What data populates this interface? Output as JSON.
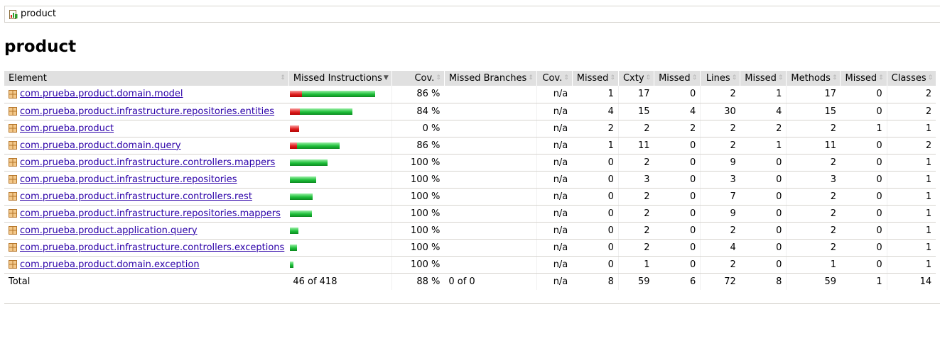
{
  "breadcrumb": {
    "label": "product"
  },
  "page_title": "product",
  "columns": [
    {
      "label": "Element"
    },
    {
      "label": "Missed Instructions"
    },
    {
      "label": "Cov."
    },
    {
      "label": "Missed Branches"
    },
    {
      "label": "Cov."
    },
    {
      "label": "Missed"
    },
    {
      "label": "Cxty"
    },
    {
      "label": "Missed"
    },
    {
      "label": "Lines"
    },
    {
      "label": "Missed"
    },
    {
      "label": "Methods"
    },
    {
      "label": "Missed"
    },
    {
      "label": "Classes"
    }
  ],
  "rows": [
    {
      "name": "com.prueba.product.domain.model",
      "instr_missed_fraction": 0.14,
      "instr_bar_total": 1.0,
      "cov": "86 %",
      "br_cov": "n/a",
      "cxty_missed": "1",
      "cxty": "17",
      "lines_missed": "0",
      "lines": "2",
      "methods_missed": "1",
      "methods": "17",
      "classes_missed": "0",
      "classes": "2"
    },
    {
      "name": "com.prueba.product.infrastructure.repositories.entities",
      "instr_missed_fraction": 0.16,
      "instr_bar_total": 0.73,
      "cov": "84 %",
      "br_cov": "n/a",
      "cxty_missed": "4",
      "cxty": "15",
      "lines_missed": "4",
      "lines": "30",
      "methods_missed": "4",
      "methods": "15",
      "classes_missed": "0",
      "classes": "2"
    },
    {
      "name": "com.prueba.product",
      "instr_missed_fraction": 1.0,
      "instr_bar_total": 0.11,
      "cov": "0 %",
      "br_cov": "n/a",
      "cxty_missed": "2",
      "cxty": "2",
      "lines_missed": "2",
      "lines": "2",
      "methods_missed": "2",
      "methods": "2",
      "classes_missed": "1",
      "classes": "1"
    },
    {
      "name": "com.prueba.product.domain.query",
      "instr_missed_fraction": 0.14,
      "instr_bar_total": 0.58,
      "cov": "86 %",
      "br_cov": "n/a",
      "cxty_missed": "1",
      "cxty": "11",
      "lines_missed": "0",
      "lines": "2",
      "methods_missed": "1",
      "methods": "11",
      "classes_missed": "0",
      "classes": "2"
    },
    {
      "name": "com.prueba.product.infrastructure.controllers.mappers",
      "instr_missed_fraction": 0.0,
      "instr_bar_total": 0.44,
      "cov": "100 %",
      "br_cov": "n/a",
      "cxty_missed": "0",
      "cxty": "2",
      "lines_missed": "0",
      "lines": "9",
      "methods_missed": "0",
      "methods": "2",
      "classes_missed": "0",
      "classes": "1"
    },
    {
      "name": "com.prueba.product.infrastructure.repositories",
      "instr_missed_fraction": 0.0,
      "instr_bar_total": 0.31,
      "cov": "100 %",
      "br_cov": "n/a",
      "cxty_missed": "0",
      "cxty": "3",
      "lines_missed": "0",
      "lines": "3",
      "methods_missed": "0",
      "methods": "3",
      "classes_missed": "0",
      "classes": "1"
    },
    {
      "name": "com.prueba.product.infrastructure.controllers.rest",
      "instr_missed_fraction": 0.0,
      "instr_bar_total": 0.27,
      "cov": "100 %",
      "br_cov": "n/a",
      "cxty_missed": "0",
      "cxty": "2",
      "lines_missed": "0",
      "lines": "7",
      "methods_missed": "0",
      "methods": "2",
      "classes_missed": "0",
      "classes": "1"
    },
    {
      "name": "com.prueba.product.infrastructure.repositories.mappers",
      "instr_missed_fraction": 0.0,
      "instr_bar_total": 0.26,
      "cov": "100 %",
      "br_cov": "n/a",
      "cxty_missed": "0",
      "cxty": "2",
      "lines_missed": "0",
      "lines": "9",
      "methods_missed": "0",
      "methods": "2",
      "classes_missed": "0",
      "classes": "1"
    },
    {
      "name": "com.prueba.product.application.query",
      "instr_missed_fraction": 0.0,
      "instr_bar_total": 0.1,
      "cov": "100 %",
      "br_cov": "n/a",
      "cxty_missed": "0",
      "cxty": "2",
      "lines_missed": "0",
      "lines": "2",
      "methods_missed": "0",
      "methods": "2",
      "classes_missed": "0",
      "classes": "1"
    },
    {
      "name": "com.prueba.product.infrastructure.controllers.exceptions",
      "instr_missed_fraction": 0.0,
      "instr_bar_total": 0.08,
      "cov": "100 %",
      "br_cov": "n/a",
      "cxty_missed": "0",
      "cxty": "2",
      "lines_missed": "0",
      "lines": "4",
      "methods_missed": "0",
      "methods": "2",
      "classes_missed": "0",
      "classes": "1"
    },
    {
      "name": "com.prueba.product.domain.exception",
      "instr_missed_fraction": 0.0,
      "instr_bar_total": 0.04,
      "cov": "100 %",
      "br_cov": "n/a",
      "cxty_missed": "0",
      "cxty": "1",
      "lines_missed": "0",
      "lines": "2",
      "methods_missed": "0",
      "methods": "1",
      "classes_missed": "0",
      "classes": "1"
    }
  ],
  "total": {
    "label": "Total",
    "instructions": "46 of 418",
    "cov": "88 %",
    "branches": "0 of 0",
    "br_cov": "n/a",
    "cxty_missed": "8",
    "cxty": "59",
    "lines_missed": "6",
    "lines": "72",
    "methods_missed": "8",
    "methods": "59",
    "classes_missed": "1",
    "classes": "14"
  },
  "colors": {
    "link": "#2b00a8",
    "bar_missed": "#e02020",
    "bar_covered": "#1fbf3a",
    "header_bg": "#e0e0e0"
  },
  "icons": {
    "breadcrumb": "report-icon",
    "package": "package-icon",
    "sort": "sort-icon"
  }
}
